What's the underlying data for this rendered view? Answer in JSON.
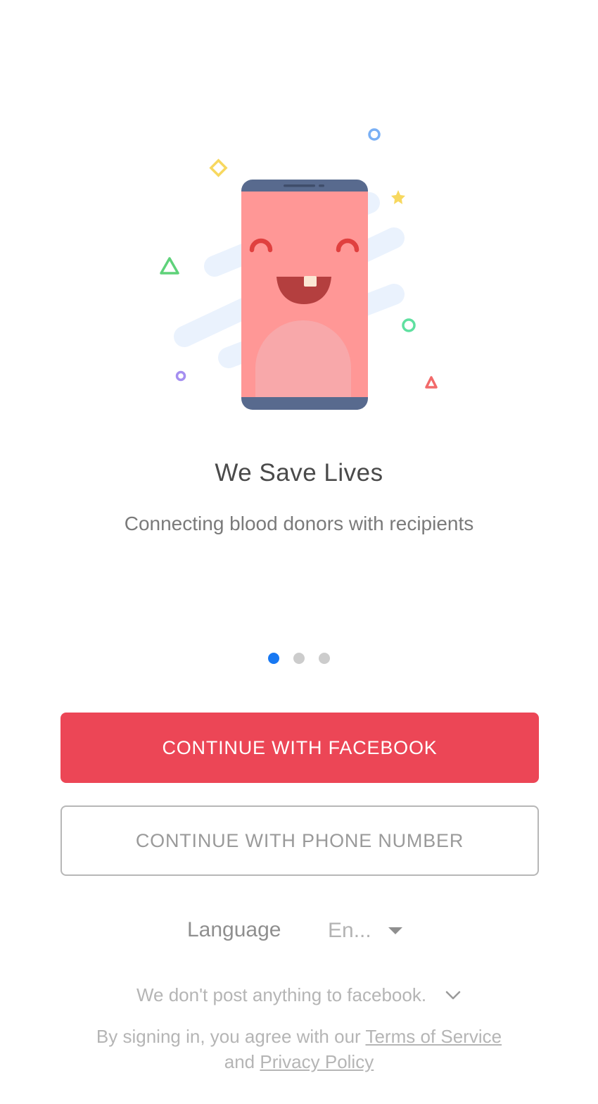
{
  "onboarding": {
    "title": "We Save Lives",
    "subtitle": "Connecting blood donors with recipients",
    "page_count": 3,
    "active_page": 1
  },
  "buttons": {
    "facebook_label": "CONTINUE WITH FACEBOOK",
    "phone_label": "CONTINUE WITH PHONE NUMBER"
  },
  "language": {
    "label": "Language",
    "selected": "En..."
  },
  "notice": {
    "text": "We don't post anything to facebook."
  },
  "legal": {
    "prefix": "By signing in, you agree with our",
    "terms_link": "Terms of Service",
    "conjunction": "and",
    "privacy_link": "Privacy Policy"
  },
  "colors": {
    "primary": "#ec4656",
    "active_dot": "#1778f2",
    "phone_body": "#586a8e",
    "phone_screen": "#ff9796"
  },
  "icons": {
    "illustration": "smiling-phone-illustration",
    "language_caret": "caret-down-icon",
    "notice_toggle": "chevron-down-icon"
  }
}
